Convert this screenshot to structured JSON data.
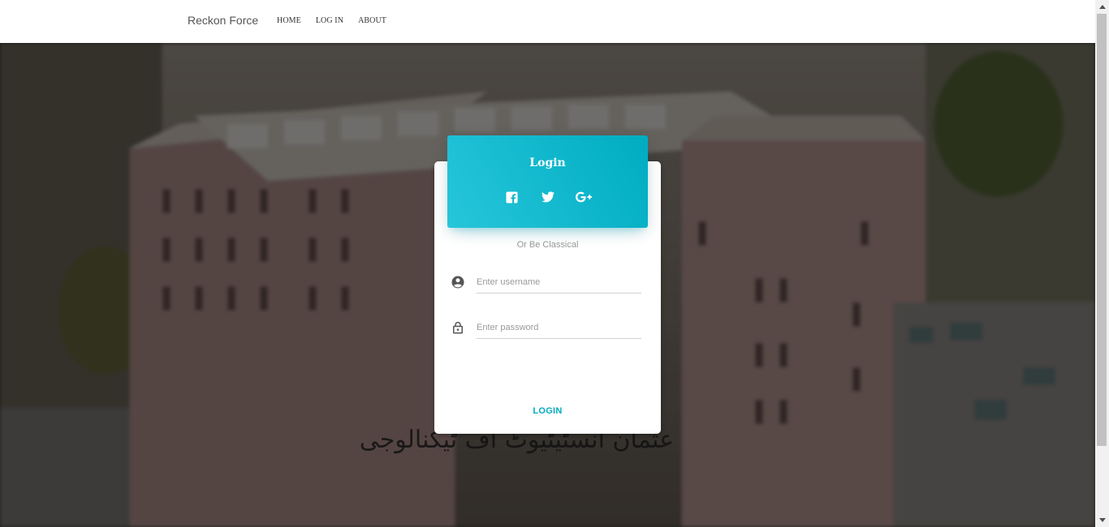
{
  "navbar": {
    "brand": "Reckon Force",
    "links": [
      {
        "label": "HOME"
      },
      {
        "label": "LOG IN"
      },
      {
        "label": "ABOUT"
      }
    ]
  },
  "login_card": {
    "title": "Login",
    "social_icons": [
      "facebook-icon",
      "twitter-icon",
      "google-plus-icon"
    ],
    "divider_text": "Or Be Classical",
    "username_field": {
      "placeholder": "Enter username",
      "value": "",
      "icon": "account-circle-icon"
    },
    "password_field": {
      "placeholder": "Enter password",
      "value": "",
      "icon": "lock-icon"
    },
    "submit_label": "LOGIN"
  },
  "colors": {
    "accent": "#00acc1",
    "accent_light": "#26c6da",
    "navbar_bg": "#ffffff"
  }
}
